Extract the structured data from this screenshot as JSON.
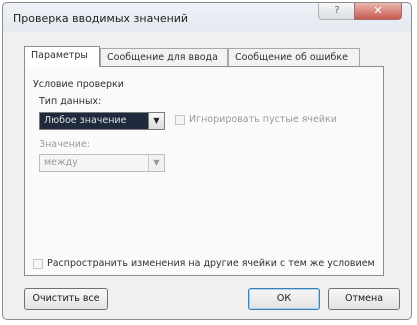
{
  "window": {
    "title": "Проверка вводимых значений",
    "help_label": "?",
    "close_label": "✕"
  },
  "tabs": [
    {
      "label": "Параметры",
      "active": true
    },
    {
      "label": "Сообщение для ввода",
      "active": false
    },
    {
      "label": "Сообщение об ошибке",
      "active": false
    }
  ],
  "settings": {
    "section_label": "Условие проверки",
    "data_type_label": "Тип данных:",
    "data_type_value": "Любое значение",
    "ignore_blank_label": "Игнорировать пустые ячейки",
    "value_label": "Значение:",
    "value_value": "между",
    "apply_all_label": "Распространить изменения на другие ячейки с тем же условием"
  },
  "buttons": {
    "clear_all": "Очистить все",
    "ok": "ОК",
    "cancel": "Отмена"
  }
}
